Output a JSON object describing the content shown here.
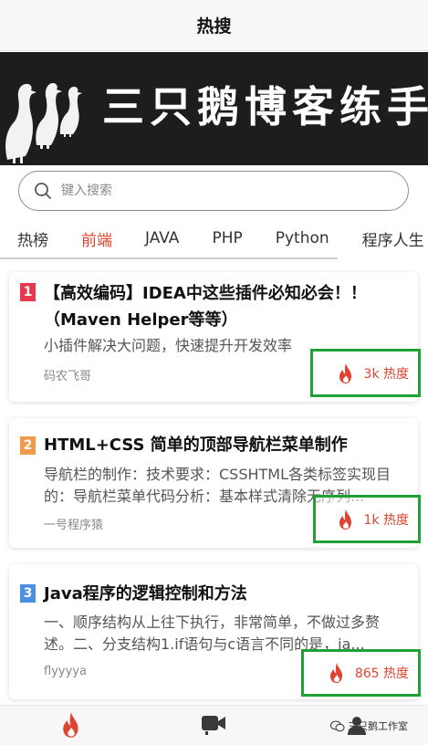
{
  "header": {
    "title": "热搜"
  },
  "banner": {
    "text": "三只鹅博客练手项目"
  },
  "search": {
    "placeholder": "键入搜索"
  },
  "tabs": [
    {
      "label": "热榜",
      "active": false
    },
    {
      "label": "前端",
      "active": true
    },
    {
      "label": "JAVA",
      "active": false
    },
    {
      "label": "PHP",
      "active": false
    },
    {
      "label": "Python",
      "active": false
    },
    {
      "label": "程序人生",
      "active": false
    }
  ],
  "articles": [
    {
      "rank": "1",
      "rank_color": "#e8384f",
      "title": "【高效编码】IDEA中这些插件必知必会！！（Maven Helper等等）",
      "description": "小插件解决大问题，快速提升开发效率",
      "author": "码农飞哥",
      "heat": "3k 热度"
    },
    {
      "rank": "2",
      "rank_color": "#f2994a",
      "title": "HTML+CSS 简单的顶部导航栏菜单制作",
      "description": "导航栏的制作：技术要求：CSSHTML各类标签实现目的：导航栏菜单代码分析：基本样式清除无序列...",
      "author": "一号程序猿",
      "heat": "1k 热度"
    },
    {
      "rank": "3",
      "rank_color": "#4a90e2",
      "title": "Java程序的逻辑控制和方法",
      "description": "一、顺序结构从上往下执行，非常简单，不做过多赘述。二、分支结构1.if语句与c语言不同的是，ja...",
      "author": "flyyyya",
      "heat": "865 热度"
    }
  ],
  "bottom_nav": [
    {
      "icon": "fire-icon",
      "active": true
    },
    {
      "icon": "video-icon",
      "active": false
    },
    {
      "icon": "user-icon",
      "active": false
    }
  ],
  "watermark": {
    "text": "三只鹅工作室"
  },
  "colors": {
    "accent": "#e0432f",
    "highlight_box": "#1ea135"
  }
}
